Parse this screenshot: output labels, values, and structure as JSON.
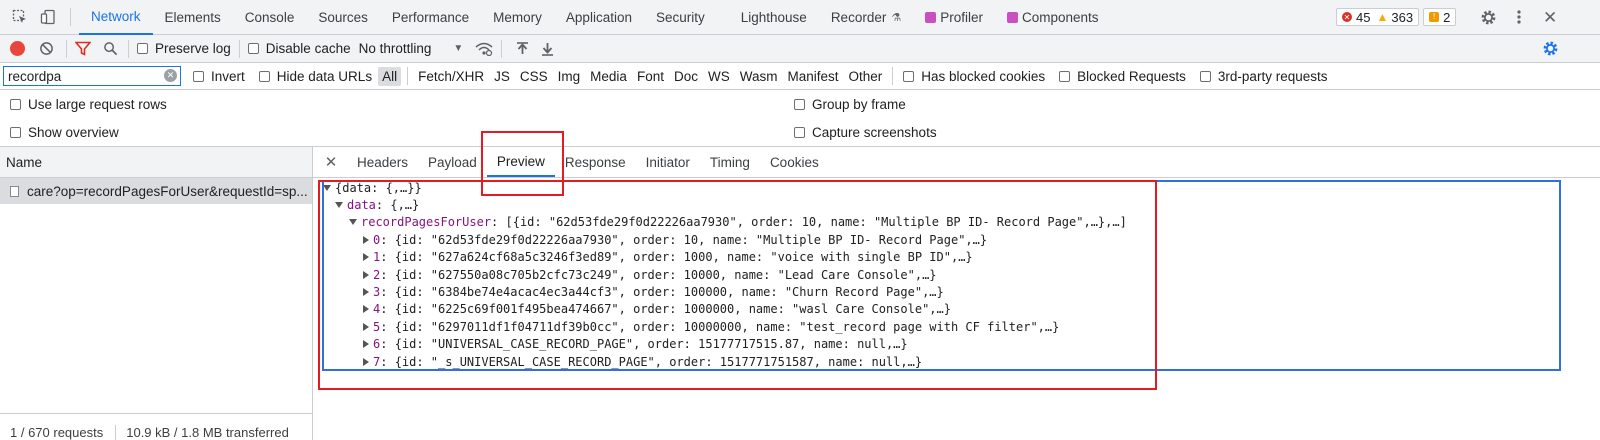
{
  "top_tabs": [
    {
      "label": "Network",
      "active": true
    },
    {
      "label": "Elements"
    },
    {
      "label": "Console"
    },
    {
      "label": "Sources"
    },
    {
      "label": "Performance"
    },
    {
      "label": "Memory"
    },
    {
      "label": "Application"
    },
    {
      "label": "Security"
    },
    {
      "label": "Lighthouse"
    },
    {
      "label": "Recorder"
    },
    {
      "label": "Profiler"
    },
    {
      "label": "Components"
    }
  ],
  "badges": {
    "errors": "45",
    "warnings": "363",
    "issues": "2"
  },
  "toolbar": {
    "preserve_log": "Preserve log",
    "disable_cache": "Disable cache",
    "throttling": "No throttling"
  },
  "filter": {
    "value": "recordpa",
    "invert": "Invert",
    "hide_data_urls": "Hide data URLs",
    "types": [
      "All",
      "Fetch/XHR",
      "JS",
      "CSS",
      "Img",
      "Media",
      "Font",
      "Doc",
      "WS",
      "Wasm",
      "Manifest",
      "Other"
    ],
    "has_blocked_cookies": "Has blocked cookies",
    "blocked_requests": "Blocked Requests",
    "third_party": "3rd-party requests"
  },
  "settings": {
    "large_rows": "Use large request rows",
    "group_by_frame": "Group by frame",
    "show_overview": "Show overview",
    "capture_screenshots": "Capture screenshots"
  },
  "left": {
    "name_header": "Name",
    "request": "care?op=recordPagesForUser&requestId=sp...",
    "status_requests": "1 / 670 requests",
    "status_transferred": "10.9 kB / 1.8 MB transferred"
  },
  "detail_tabs": [
    "Headers",
    "Payload",
    "Preview",
    "Response",
    "Initiator",
    "Timing",
    "Cookies"
  ],
  "active_detail_tab": "Preview",
  "preview": {
    "root": "{data: {,…}}",
    "data_key": "data",
    "data_val": "{,…}",
    "rpfu_key": "recordPagesForUser",
    "rpfu_val": "[{id: \"62d53fde29f0d22226aa7930\", order: 10, name: \"Multiple BP ID- Record Page\",…},…]",
    "items": [
      {
        "idx": "0",
        "text": "{id: \"62d53fde29f0d22226aa7930\", order: 10, name: \"Multiple BP ID- Record Page\",…}"
      },
      {
        "idx": "1",
        "text": "{id: \"627a624cf68a5c3246f3ed89\", order: 1000, name: \"voice with single BP ID\",…}"
      },
      {
        "idx": "2",
        "text": "{id: \"627550a08c705b2cfc73c249\", order: 10000, name: \"Lead Care Console\",…}"
      },
      {
        "idx": "3",
        "text": "{id: \"6384be74e4acac4ec3a44cf3\", order: 100000, name: \"Churn Record Page\",…}"
      },
      {
        "idx": "4",
        "text": "{id: \"6225c69f001f495bea474667\", order: 1000000, name: \"wasl Care Console\",…}"
      },
      {
        "idx": "5",
        "text": "{id: \"6297011df1f04711df39b0cc\", order: 10000000, name: \"test_record page with CF filter\",…}"
      },
      {
        "idx": "6",
        "text": "{id: \"UNIVERSAL_CASE_RECORD_PAGE\", order: 15177717515.87, name: null,…}"
      },
      {
        "idx": "7",
        "text": "{id: \"_s_UNIVERSAL_CASE_RECORD_PAGE\", order: 1517771751587, name: null,…}"
      }
    ]
  },
  "colors": {
    "accent": "#1a73e8",
    "annotation_red": "#e31c23",
    "annotation_blue": "#2f6fde",
    "record_red": "#e8453c",
    "key_purple": "#881280"
  }
}
